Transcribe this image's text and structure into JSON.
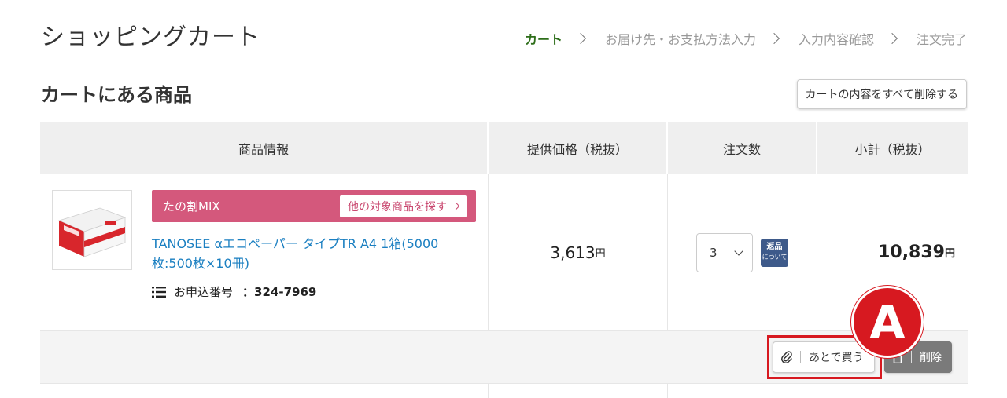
{
  "page": {
    "title": "ショッピングカート"
  },
  "steps": [
    {
      "label": "カート",
      "active": true
    },
    {
      "label": "お届け先・お支払方法入力",
      "active": false
    },
    {
      "label": "入力内容確認",
      "active": false
    },
    {
      "label": "注文完了",
      "active": false
    }
  ],
  "section": {
    "title": "カートにある商品",
    "clear_label": "カートの内容をすべて削除する"
  },
  "table": {
    "headers": [
      "商品情報",
      "提供価格（税抜）",
      "注文数",
      "小計（税抜）"
    ]
  },
  "item": {
    "tag_label": "たの割MIX",
    "tag_link": "他の対象商品を探す",
    "name": "TANOSEE αエコペーパー タイプTR A4 1箱(5000枚:500枚×10冊)",
    "number_label": "お申込番号",
    "number_sep": "：",
    "number": "324-7969",
    "price": "3,613",
    "currency": "円",
    "quantity": "3",
    "return_badge_line1": "返品",
    "return_badge_line2": "について",
    "subtotal": "10,839"
  },
  "actions": {
    "later_label": "あとで買う",
    "delete_label": "削除"
  },
  "annotation": {
    "marker": "A"
  },
  "colors": {
    "active_step": "#2e6e1a",
    "tag_bg": "#d4587c",
    "link": "#1a7fc1",
    "highlight": "#d71920",
    "badge": "#3e5a8a"
  }
}
